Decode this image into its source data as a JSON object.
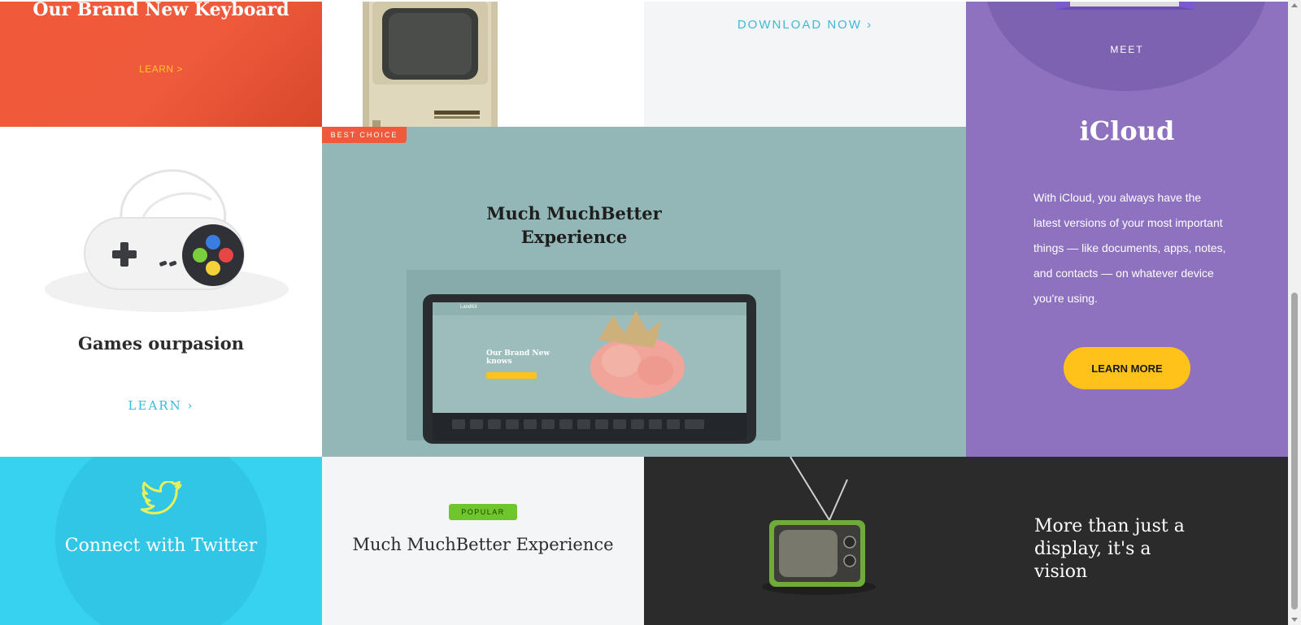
{
  "keyboard_card": {
    "title": "Our Brand New Keyboard",
    "link": "LEARN >"
  },
  "download_card": {
    "link": "DOWNLOAD NOW ›"
  },
  "icloud_card": {
    "eyebrow": "MEET",
    "title": "iCloud",
    "body": "With iCloud, you always have the latest versions of your most important things — like documents, apps, notes, and contacts — on whatever device you're using.",
    "button": "LEARN MORE"
  },
  "games_card": {
    "title": "Games ourpasion",
    "link": "LEARN ›"
  },
  "featured_card": {
    "badge": "BEST CHOICE",
    "title": "Much MuchBetter Experience",
    "tablet_screen": {
      "brand": "LandKit",
      "headline": "Our Brand New knows"
    }
  },
  "twitter_card": {
    "title": "Connect with Twitter"
  },
  "popular_card": {
    "badge": "POPULAR",
    "title": "Much MuchBetter Experience"
  },
  "tv_card": {
    "title": "More than just a display, it's a vision"
  },
  "colors": {
    "orange": "#ef5a3c",
    "purple": "#8e72bf",
    "teal": "#92b7b6",
    "cyan": "#36d2f0",
    "dark": "#2b2b2b",
    "yellow": "#ffc21a",
    "green": "#6fc62c",
    "link_blue": "#3eb8d8"
  }
}
